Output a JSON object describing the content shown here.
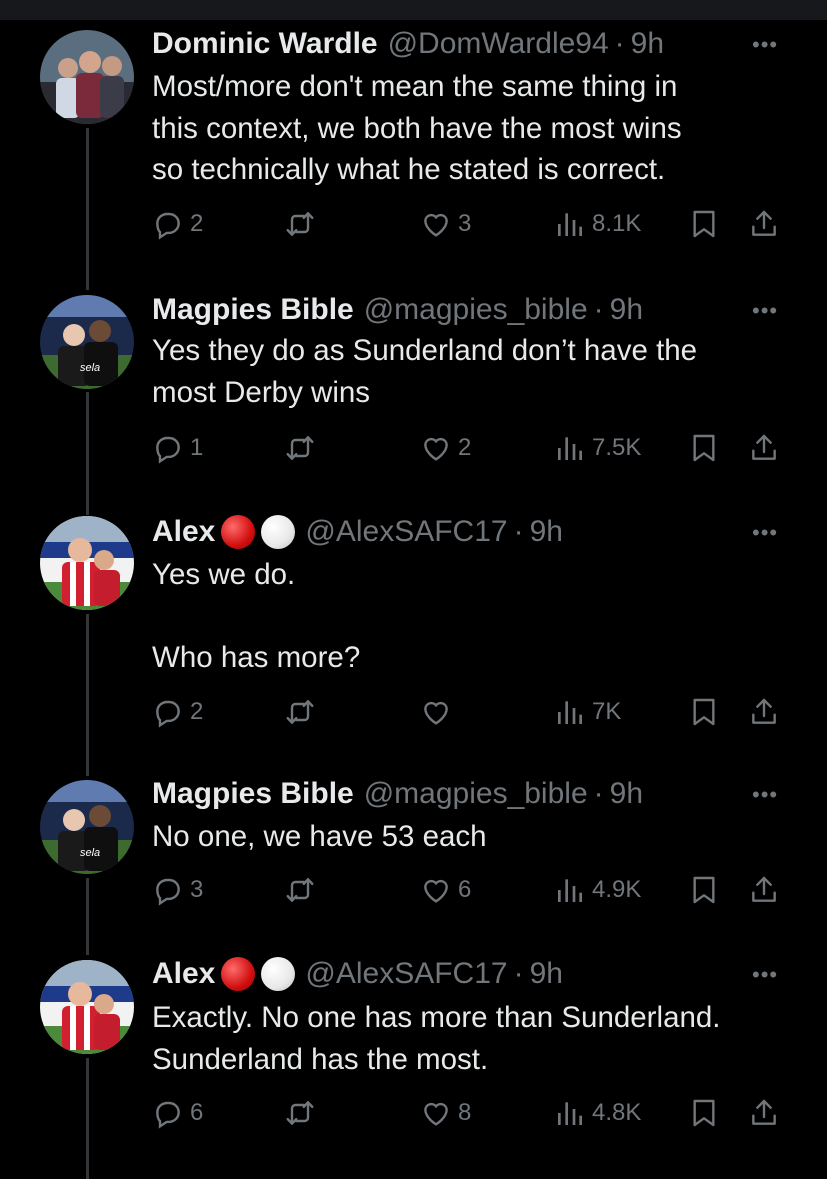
{
  "tweets": [
    {
      "name": "Dominic Wardle",
      "handle": "@DomWardle94",
      "dot": "·",
      "time": "9h",
      "emojis": false,
      "text": "Most/more don't mean the same thing in\nthis context, we both have the most wins\nso technically what he stated is correct.",
      "replies": "2",
      "retweets": "",
      "likes": "3",
      "views": "8.1K"
    },
    {
      "name": "Magpies Bible",
      "handle": "@magpies_bible",
      "dot": "·",
      "time": "9h",
      "emojis": false,
      "text": "Yes they do as Sunderland don’t have the\nmost Derby wins",
      "replies": "1",
      "retweets": "",
      "likes": "2",
      "views": "7.5K"
    },
    {
      "name": "Alex",
      "handle": "@AlexSAFC17",
      "dot": "·",
      "time": "9h",
      "emojis": true,
      "text": "Yes we do.\n\nWho has more?",
      "replies": "2",
      "retweets": "",
      "likes": "",
      "views": "7K"
    },
    {
      "name": "Magpies Bible",
      "handle": "@magpies_bible",
      "dot": "·",
      "time": "9h",
      "emojis": false,
      "text": "No one, we have 53 each",
      "replies": "3",
      "retweets": "",
      "likes": "6",
      "views": "4.9K"
    },
    {
      "name": "Alex",
      "handle": "@AlexSAFC17",
      "dot": "·",
      "time": "9h",
      "emojis": true,
      "text": "Exactly. No one has more than Sunderland.\nSunderland has the most.",
      "replies": "6",
      "retweets": "",
      "likes": "8",
      "views": "4.8K"
    }
  ],
  "more_label": "•••",
  "avatar_text": "sela",
  "icons": {
    "reply": "reply-icon",
    "retweet": "retweet-icon",
    "like": "heart-icon",
    "views": "views-icon",
    "bookmark": "bookmark-icon",
    "share": "share-icon",
    "more": "more-icon"
  },
  "colors": {
    "background": "#000000",
    "text": "#e7e9ea",
    "secondary": "#71767b",
    "thread_line": "#333639"
  }
}
